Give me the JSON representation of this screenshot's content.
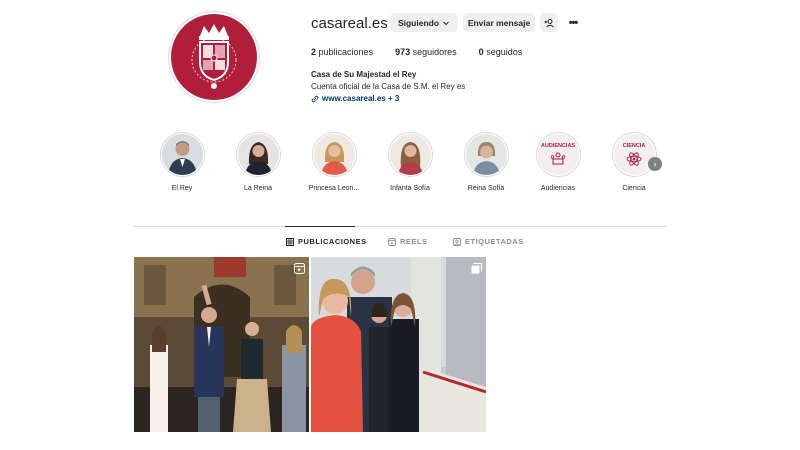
{
  "profile": {
    "username": "casareal.es",
    "follow_label": "Siguiendo",
    "message_label": "Enviar mensaje",
    "suggest_icon": "add-person-icon",
    "more_icon": "more-options-icon"
  },
  "stats": {
    "posts_count": "2",
    "posts_label": "publicaciones",
    "followers_count": "973",
    "followers_label": "seguidores",
    "following_count": "0",
    "following_label": "seguidos"
  },
  "bio": {
    "name": "Casa de Su Majestad el Rey",
    "description": "Cuenta oficial de la Casa de S.M. el Rey es",
    "link": "www.casareal.es + 3"
  },
  "highlights": [
    {
      "label": "El Rey"
    },
    {
      "label": "La Reina"
    },
    {
      "label": "Princesa Leon..."
    },
    {
      "label": "Infanta Sofía"
    },
    {
      "label": "Reina Sofía"
    },
    {
      "label": "Audiencias",
      "cover_text": "AUDIENCIAS"
    },
    {
      "label": "Ciencia",
      "cover_text": "CIENCIA"
    }
  ],
  "tabs": [
    {
      "label": "PUBLICACIONES",
      "active": true
    },
    {
      "label": "REELS",
      "active": false
    },
    {
      "label": "ETIQUETADAS",
      "active": false
    }
  ],
  "colors": {
    "brand_red": "#b11e3a",
    "verified_blue": "#1d9bf0",
    "link_blue": "#00376b"
  }
}
